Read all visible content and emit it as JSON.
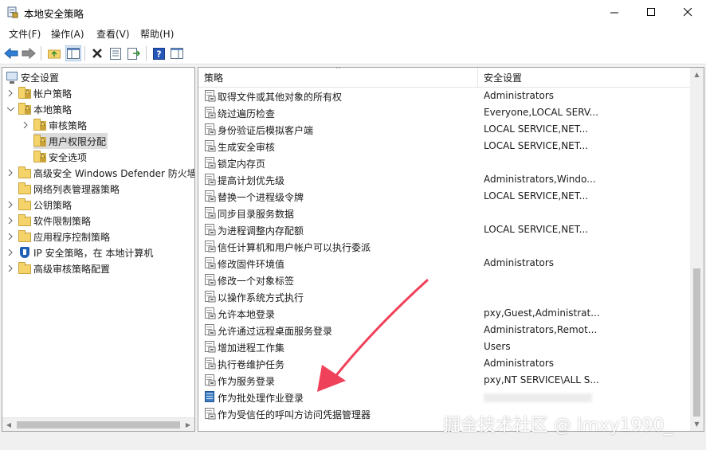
{
  "window": {
    "title": "本地安全策略"
  },
  "menu": [
    "文件(F)",
    "操作(A)",
    "查看(V)",
    "帮助(H)"
  ],
  "tree": [
    {
      "label": "安全设置",
      "icon": "monitor-icon",
      "level": 0,
      "expand": "none"
    },
    {
      "label": "帐户策略",
      "icon": "folder-lock-icon",
      "level": 1,
      "expand": "collapsed"
    },
    {
      "label": "本地策略",
      "icon": "folder-lock-icon",
      "level": 1,
      "expand": "expanded"
    },
    {
      "label": "审核策略",
      "icon": "folder-lock-icon",
      "level": 2,
      "expand": "collapsed"
    },
    {
      "label": "用户权限分配",
      "icon": "folder-lock-icon",
      "level": 2,
      "expand": "none",
      "selected": true
    },
    {
      "label": "安全选项",
      "icon": "folder-lock-icon",
      "level": 2,
      "expand": "none"
    },
    {
      "label": "高级安全 Windows Defender 防火墙",
      "icon": "folder-icon",
      "level": 1,
      "expand": "collapsed"
    },
    {
      "label": "网络列表管理器策略",
      "icon": "folder-icon",
      "level": 1,
      "expand": "none"
    },
    {
      "label": "公钥策略",
      "icon": "folder-icon",
      "level": 1,
      "expand": "collapsed"
    },
    {
      "label": "软件限制策略",
      "icon": "folder-icon",
      "level": 1,
      "expand": "collapsed"
    },
    {
      "label": "应用程序控制策略",
      "icon": "folder-icon",
      "level": 1,
      "expand": "collapsed"
    },
    {
      "label": "IP 安全策略，在 本地计算机",
      "icon": "shield-icon",
      "level": 1,
      "expand": "collapsed"
    },
    {
      "label": "高级审核策略配置",
      "icon": "folder-icon",
      "level": 1,
      "expand": "collapsed"
    }
  ],
  "list": {
    "columns": {
      "policy": "策略",
      "setting": "安全设置"
    },
    "rows": [
      {
        "policy": "取得文件或其他对象的所有权",
        "setting": "Administrators"
      },
      {
        "policy": "绕过遍历检查",
        "setting": "Everyone,LOCAL SERV..."
      },
      {
        "policy": "身份验证后模拟客户端",
        "setting": "LOCAL SERVICE,NET..."
      },
      {
        "policy": "生成安全审核",
        "setting": "LOCAL SERVICE,NET..."
      },
      {
        "policy": "锁定内存页",
        "setting": ""
      },
      {
        "policy": "提高计划优先级",
        "setting": "Administrators,Windo..."
      },
      {
        "policy": "替换一个进程级令牌",
        "setting": "LOCAL SERVICE,NET..."
      },
      {
        "policy": "同步目录服务数据",
        "setting": ""
      },
      {
        "policy": "为进程调整内存配额",
        "setting": "LOCAL SERVICE,NET..."
      },
      {
        "policy": "信任计算机和用户帐户可以执行委派",
        "setting": ""
      },
      {
        "policy": "修改固件环境值",
        "setting": "Administrators"
      },
      {
        "policy": "修改一个对象标签",
        "setting": ""
      },
      {
        "policy": "以操作系统方式执行",
        "setting": ""
      },
      {
        "policy": "允许本地登录",
        "setting": "pxy,Guest,Administrat..."
      },
      {
        "policy": "允许通过远程桌面服务登录",
        "setting": "Administrators,Remot..."
      },
      {
        "policy": "增加进程工作集",
        "setting": "Users"
      },
      {
        "policy": "执行卷维护任务",
        "setting": "Administrators"
      },
      {
        "policy": "作为服务登录",
        "setting": "pxy,NT SERVICE\\ALL S..."
      },
      {
        "policy": "作为批处理作业登录",
        "setting": "",
        "blurred": true,
        "highlighted": true
      },
      {
        "policy": "作为受信任的呼叫方访问凭据管理器",
        "setting": ""
      }
    ]
  },
  "watermark": "掘金技术社区 @ lmxy1990_",
  "colors": {
    "arrow": "#f0415a",
    "selection": "#dcdcdc",
    "folder": "#f4d36a"
  }
}
